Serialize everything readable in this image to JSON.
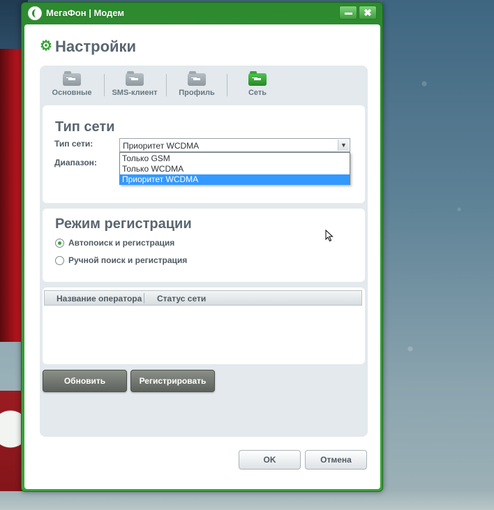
{
  "window": {
    "title": "МегаФон | Модем",
    "minimize_glyph": "",
    "close_glyph": "✖"
  },
  "page": {
    "title": "Настройки",
    "title_icon": "gear-icon"
  },
  "tabs": [
    {
      "label": "Основные",
      "icon": "folder-key-icon",
      "active": false
    },
    {
      "label": "SMS-клиент",
      "icon": "folder-key-icon",
      "active": false
    },
    {
      "label": "Профиль",
      "icon": "folder-key-icon",
      "active": false
    },
    {
      "label": "Сеть",
      "icon": "folder-key-icon",
      "active": true
    }
  ],
  "network_type": {
    "section_title": "Тип сети",
    "type_label": "Тип сети:",
    "band_label": "Диапазон:",
    "selected_value": "Приоритет WCDMA",
    "options": [
      "Только GSM",
      "Только WCDMA",
      "Приоритет WCDMA"
    ],
    "highlighted_option": "Приоритет WCDMA"
  },
  "registration": {
    "section_title": "Режим регистрации",
    "options": [
      {
        "label": "Автопоиск и регистрация",
        "checked": true
      },
      {
        "label": "Ручной поиск и регистрация",
        "checked": false
      }
    ]
  },
  "operators_table": {
    "columns": [
      "Название оператора",
      "Статус сети"
    ],
    "rows": []
  },
  "actions": {
    "refresh_label": "Обновить",
    "register_label": "Регистрировать"
  },
  "dialog": {
    "ok_label": "OK",
    "cancel_label": "Отмена"
  },
  "colors": {
    "brand_green": "#3aa23a",
    "selection_blue": "#3399ff",
    "panel_bg": "#e3e9ec"
  }
}
